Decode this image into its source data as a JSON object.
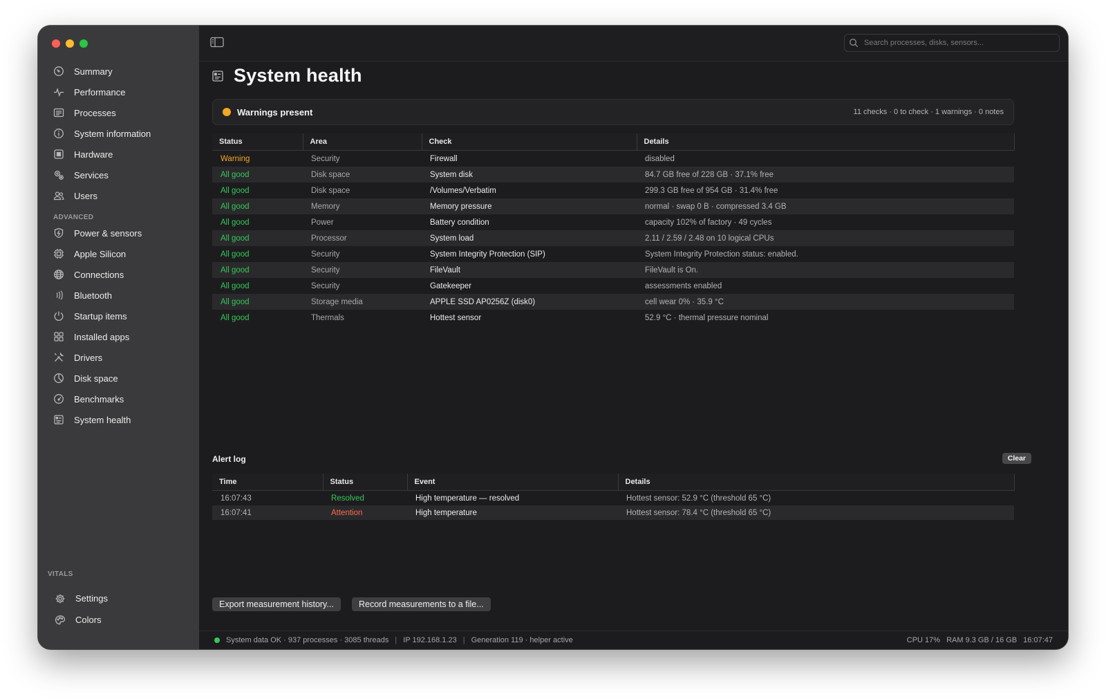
{
  "sidebar": {
    "items": [
      {
        "label": "Summary",
        "icon": "gauge-icon"
      },
      {
        "label": "Performance",
        "icon": "pulse-icon"
      },
      {
        "label": "Processes",
        "icon": "list-icon"
      },
      {
        "label": "System information",
        "icon": "info-icon"
      },
      {
        "label": "Hardware",
        "icon": "chip-icon"
      },
      {
        "label": "Services",
        "icon": "gears-icon"
      },
      {
        "label": "Users",
        "icon": "users-icon"
      }
    ],
    "advanced_label": "ADVANCED",
    "advanced_items": [
      {
        "label": "Power & sensors",
        "icon": "shield-icon"
      },
      {
        "label": "Apple Silicon",
        "icon": "cpu-icon"
      },
      {
        "label": "Connections",
        "icon": "globe-icon"
      },
      {
        "label": "Bluetooth",
        "icon": "bluetooth-wave-icon"
      },
      {
        "label": "Startup items",
        "icon": "power-icon"
      },
      {
        "label": "Installed apps",
        "icon": "apps-grid-icon"
      },
      {
        "label": "Drivers",
        "icon": "tools-icon"
      },
      {
        "label": "Disk space",
        "icon": "pie-icon"
      },
      {
        "label": "Benchmarks",
        "icon": "speedometer-icon"
      },
      {
        "label": "System health",
        "icon": "health-list-icon"
      }
    ],
    "vitals_label": "VITALS",
    "bottom_items": [
      {
        "label": "Settings",
        "icon": "gear-icon"
      },
      {
        "label": "Colors",
        "icon": "palette-icon"
      }
    ]
  },
  "toolbar": {
    "search_placeholder": "Search processes, disks, sensors..."
  },
  "page": {
    "title": "System health"
  },
  "banner": {
    "label": "Warnings present",
    "summary": "11 checks · 0 to check · 1 warnings · 0 notes",
    "dot_color": "#f5a623"
  },
  "health_table": {
    "columns": [
      "Status",
      "Area",
      "Check",
      "Details"
    ],
    "rows": [
      {
        "status": "Warning",
        "area": "Security",
        "check": "Firewall",
        "details": "disabled",
        "level": "warn"
      },
      {
        "status": "All good",
        "area": "Disk space",
        "check": "System disk",
        "details": "84.7 GB free of 228 GB · 37.1% free",
        "level": "good"
      },
      {
        "status": "All good",
        "area": "Disk space",
        "check": "/Volumes/Verbatim",
        "details": "299.3 GB free of 954 GB · 31.4% free",
        "level": "good"
      },
      {
        "status": "All good",
        "area": "Memory",
        "check": "Memory pressure",
        "details": "normal · swap 0 B · compressed 3.4 GB",
        "level": "good"
      },
      {
        "status": "All good",
        "area": "Power",
        "check": "Battery condition",
        "details": "capacity 102% of factory · 49 cycles",
        "level": "good"
      },
      {
        "status": "All good",
        "area": "Processor",
        "check": "System load",
        "details": "2.11 / 2.59 / 2.48 on 10 logical CPUs",
        "level": "good"
      },
      {
        "status": "All good",
        "area": "Security",
        "check": "System Integrity Protection (SIP)",
        "details": "System Integrity Protection status: enabled.",
        "level": "good"
      },
      {
        "status": "All good",
        "area": "Security",
        "check": "FileVault",
        "details": "FileVault is On.",
        "level": "good"
      },
      {
        "status": "All good",
        "area": "Security",
        "check": "Gatekeeper",
        "details": "assessments enabled",
        "level": "good"
      },
      {
        "status": "All good",
        "area": "Storage media",
        "check": "APPLE SSD AP0256Z (disk0)",
        "details": "cell wear 0% · 35.9 °C",
        "level": "good"
      },
      {
        "status": "All good",
        "area": "Thermals",
        "check": "Hottest sensor",
        "details": "52.9 °C · thermal pressure nominal",
        "level": "good"
      }
    ]
  },
  "alert_log": {
    "title": "Alert log",
    "clear_label": "Clear",
    "columns": [
      "Time",
      "Status",
      "Event",
      "Details"
    ],
    "rows": [
      {
        "time": "16:07:43",
        "status": "Resolved",
        "event": "High temperature — resolved",
        "details": "Hottest sensor: 52.9 °C (threshold 65 °C)",
        "level": "res"
      },
      {
        "time": "16:07:41",
        "status": "Attention",
        "event": "High temperature",
        "details": "Hottest sensor: 78.4 °C (threshold 65 °C)",
        "level": "att"
      }
    ]
  },
  "footer": {
    "export_label": "Export measurement history...",
    "record_label": "Record measurements to a file..."
  },
  "statusbar": {
    "dot_color": "#35c759",
    "left": "System data OK · 937 processes · 3085 threads",
    "ip": "IP 192.168.1.23",
    "generation": "Generation 119 · helper active",
    "cpu": "CPU 17%",
    "ram": "RAM 9.3 GB / 16 GB",
    "time": "16:07:47",
    "separator": "|"
  }
}
